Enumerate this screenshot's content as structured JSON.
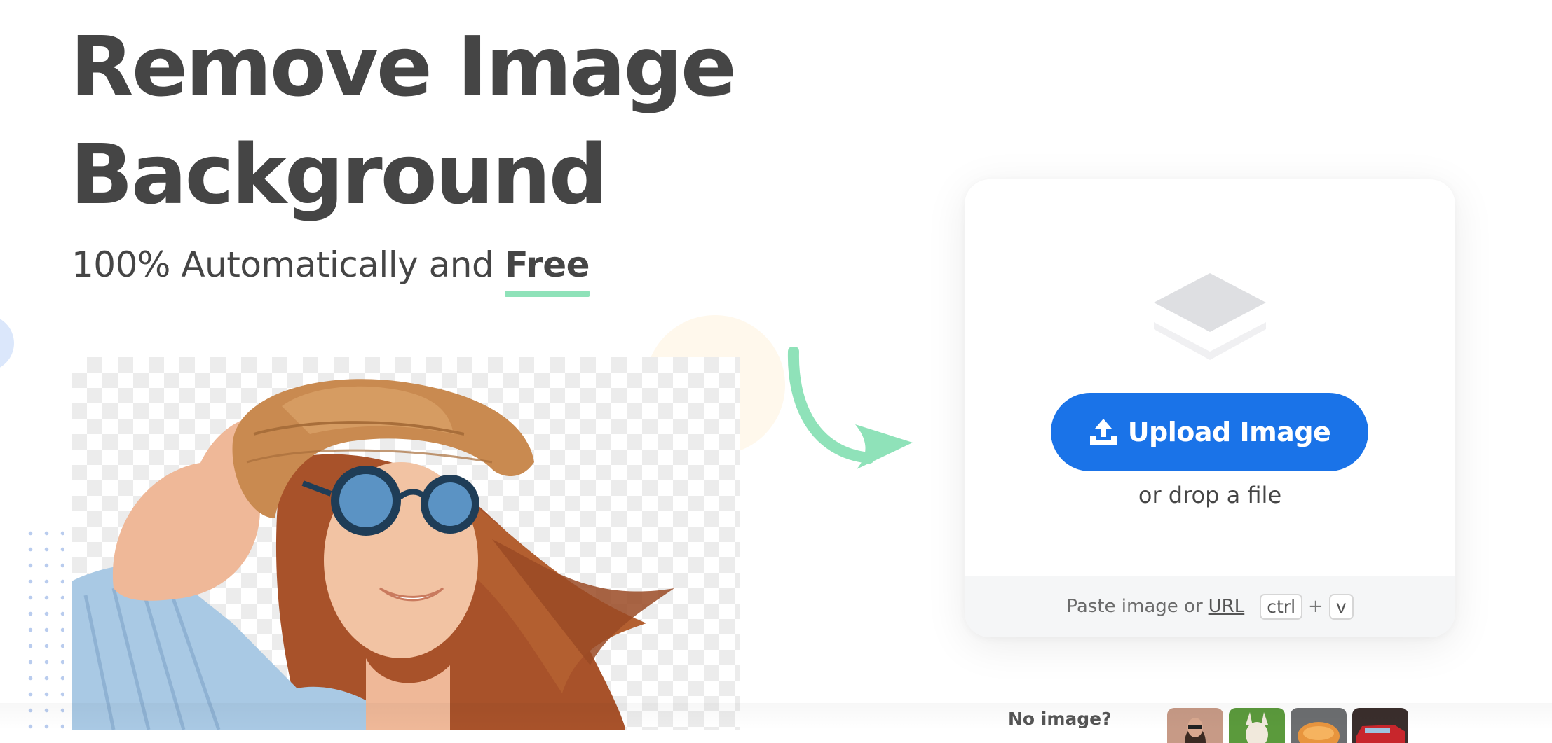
{
  "hero": {
    "title_line1": "Remove Image",
    "title_line2": "Background",
    "subtitle_prefix": "100% Automatically and ",
    "subtitle_emphasis": "Free"
  },
  "upload": {
    "button_label": "Upload Image",
    "drop_text": "or drop a file",
    "paste_prefix": "Paste image or",
    "url_link": "URL",
    "shortcut_key1": "ctrl",
    "shortcut_plus": "+",
    "shortcut_key2": "v"
  },
  "samples": {
    "prompt": "No image?",
    "thumbnails": [
      "sample-person",
      "sample-animal",
      "sample-food",
      "sample-car"
    ]
  },
  "colors": {
    "primary": "#1a73e8",
    "accent_green": "#8fe2b9",
    "heading": "#454545"
  }
}
